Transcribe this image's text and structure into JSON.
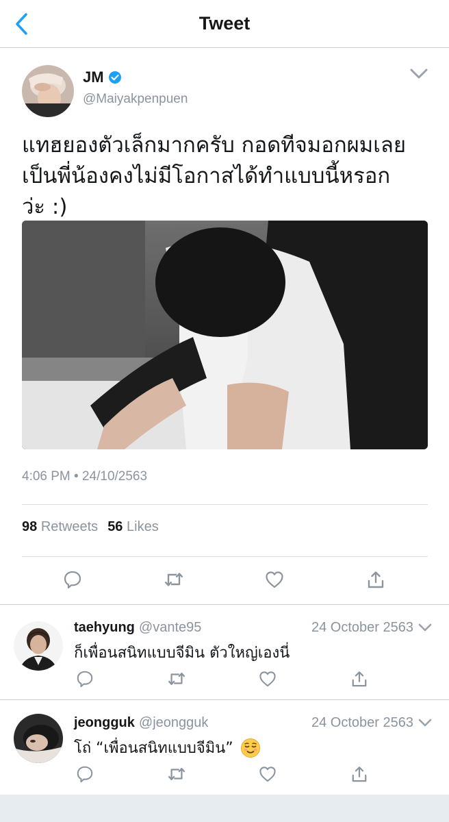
{
  "navbar": {
    "title": "Tweet",
    "back_icon": "chevron-left-icon"
  },
  "colors": {
    "accent": "#1da1f2",
    "muted": "#8a949e",
    "text": "#14171a",
    "divider": "#d9dde1"
  },
  "tweet": {
    "author_name": "JM",
    "author_handle": "@Maiyakpenpuen",
    "verified": true,
    "text": "แทฮยองตัวเล็กมากครับ กอดทีจมอกผมเลย\nเป็นพี่น้องคงไม่มีโอกาสได้ทำแบบนี้หรอก\nว่ะ :)",
    "timestamp": "4:06 PM • 24/10/2563",
    "retweets_count": "98",
    "retweets_label": "Retweets",
    "likes_count": "56",
    "likes_label": "Likes"
  },
  "replies": [
    {
      "name": "taehyung",
      "handle": "@vante95",
      "date": "24 October 2563",
      "text": "ก็เพื่อนสนิทแบบจีมิน ตัวใหญ่เองนี่",
      "emoji": ""
    },
    {
      "name": "jeongguk",
      "handle": "@jeongguk",
      "date": "24 October 2563",
      "text": "โถ่ “เพื่อนสนิทแบบจีมิน”",
      "emoji": "relieved-face-emoji"
    }
  ]
}
